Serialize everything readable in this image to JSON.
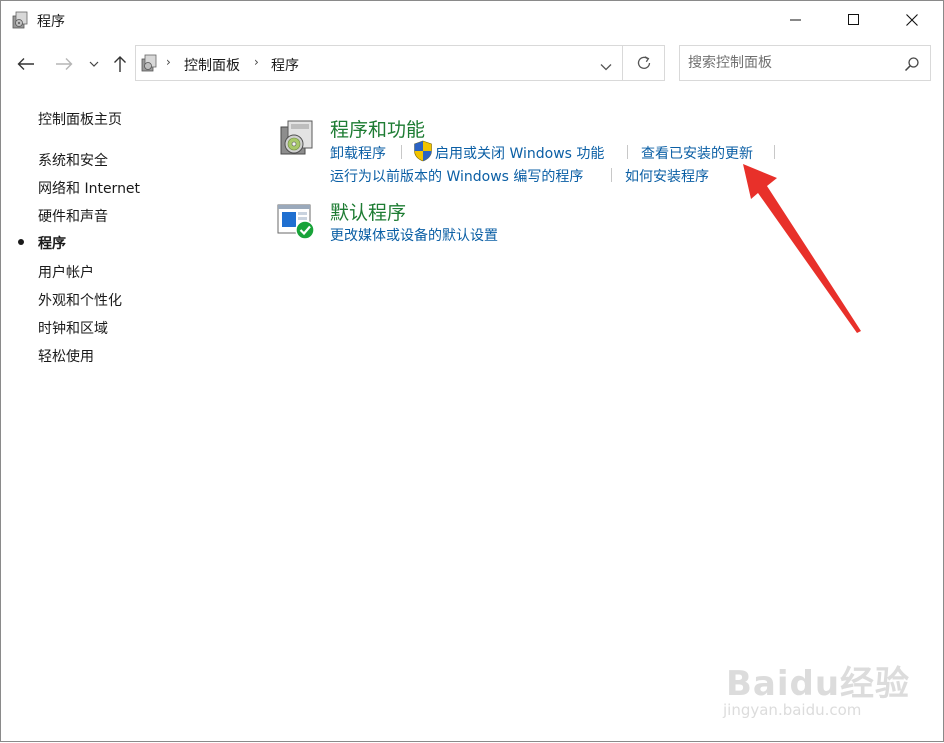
{
  "window": {
    "title": "程序",
    "controls": {
      "minimize": "minimize",
      "maximize": "maximize",
      "close": "close"
    }
  },
  "address": {
    "crumbs": [
      "控制面板",
      "程序"
    ],
    "search_placeholder": "搜索控制面板"
  },
  "sidebar": {
    "home": "控制面板主页",
    "items": [
      "系统和安全",
      "网络和 Internet",
      "硬件和声音",
      "程序",
      "用户帐户",
      "外观和个性化",
      "时钟和区域",
      "轻松使用"
    ],
    "current": "程序"
  },
  "main": {
    "groups": [
      {
        "title": "程序和功能",
        "icon": "programs-features-icon",
        "links": [
          "卸载程序",
          "启用或关闭 Windows 功能",
          "查看已安装的更新",
          "运行为以前版本的 Windows 编写的程序",
          "如何安装程序"
        ]
      },
      {
        "title": "默认程序",
        "icon": "default-programs-icon",
        "links": [
          "更改媒体或设备的默认设置"
        ]
      }
    ]
  },
  "annotation": {
    "color": "#e8302a",
    "type": "red-arrow"
  },
  "watermark": {
    "brand": "Baidu经验",
    "url": "jingyan.baidu.com"
  },
  "colors": {
    "group_title": "#1e7c33",
    "link": "#0b5fa5"
  }
}
